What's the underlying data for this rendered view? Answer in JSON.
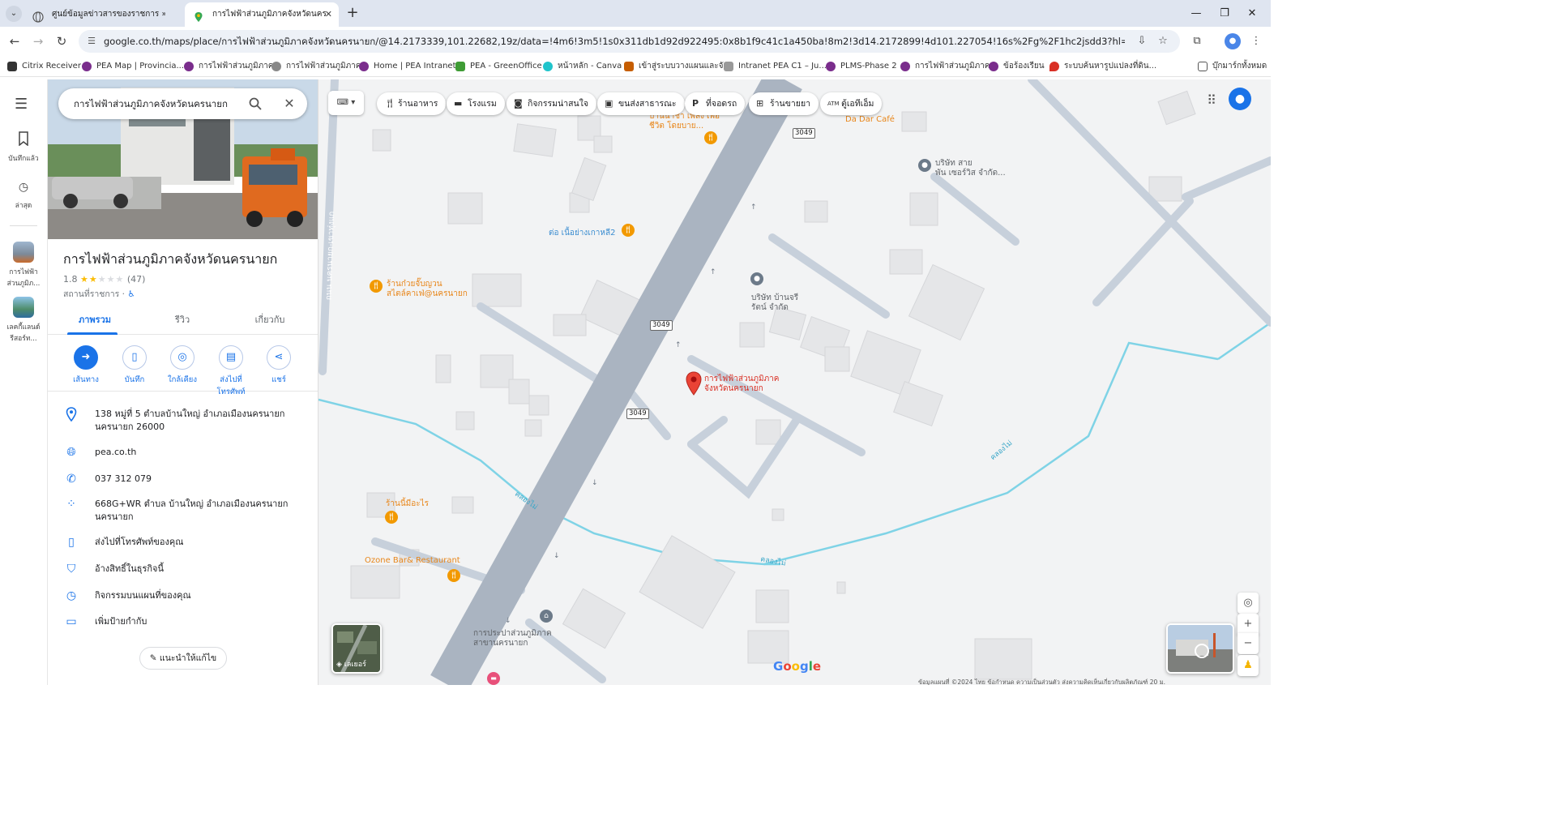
{
  "browser": {
    "tabs": [
      {
        "title": "ศูนย์ข้อมูลข่าวสารของราชการ » PEA",
        "active": false
      },
      {
        "title": "การไฟฟ้าส่วนภูมิภาคจังหวัดนครนายก",
        "active": true
      }
    ],
    "url": "google.co.th/maps/place/การไฟฟ้าส่วนภูมิภาคจังหวัดนครนายก/@14.2173339,101.22682,19z/data=!4m6!3m5!1s0x311db1d92d922495:0x8b1f9c41c1a450ba!8m2!3d14.2172899!4d101.227054!16s%2Fg%2F1hc2jsdd3?hl=th&entry=ttu",
    "bookmarks": [
      {
        "label": "Citrix Receiver",
        "color": "#333"
      },
      {
        "label": "PEA Map | Provincia...",
        "color": "#7a2d8c"
      },
      {
        "label": "การไฟฟ้าส่วนภูมิภาค",
        "color": "#7a2d8c"
      },
      {
        "label": "การไฟฟ้าส่วนภูมิภาค",
        "color": "#555"
      },
      {
        "label": "Home | PEA Intranet",
        "color": "#7a2d8c"
      },
      {
        "label": "PEA - GreenOffice",
        "color": "#3f9c35"
      },
      {
        "label": "หน้าหลัก - Canva",
        "color": "#20c4cb"
      },
      {
        "label": "เข้าสู่ระบบวางแผนและจั...",
        "color": "#c65d00"
      },
      {
        "label": "Intranet PEA C1 – Ju...",
        "color": "#888"
      },
      {
        "label": "PLMS-Phase 2",
        "color": "#7a2d8c"
      },
      {
        "label": "การไฟฟ้าส่วนภูมิภาค",
        "color": "#7a2d8c"
      },
      {
        "label": "ข้อร้องเรียน",
        "color": "#7a2d8c"
      },
      {
        "label": "ระบบค้นหารูปแปลงที่ดิน...",
        "color": "#d93025"
      }
    ],
    "all_bookmarks": "บุ๊กมาร์กทั้งหมด"
  },
  "rail": {
    "saved": "บันทึกแล้ว",
    "recent": "ล่าสุด",
    "recent_places": [
      "การไฟฟ้า ส่วนภูมิภ...",
      "เลคกี้แลนด์ รีสอร์ท..."
    ]
  },
  "search": {
    "query": "การไฟฟ้าส่วนภูมิภาคจังหวัดนครนายก"
  },
  "place": {
    "title": "การไฟฟ้าส่วนภูมิภาคจังหวัดนครนายก",
    "rating": "1.8",
    "rating_value": 1.8,
    "reviews": "(47)",
    "category": "สถานที่ราชการ",
    "tabs": [
      "ภาพรวม",
      "รีวิว",
      "เกี่ยวกับ"
    ],
    "actions": [
      "เส้นทาง",
      "บันทึก",
      "ใกล้เคียง",
      "ส่งไปที่โทรศัพท์",
      "แชร์"
    ],
    "address_1": "138 หมู่ที่ 5 ตำบลบ้านใหญ่ อำเภอเมืองนครนายก",
    "address_2": "นครนายก 26000",
    "website": "pea.co.th",
    "phone": "037 312 079",
    "plus_code_1": "668G+WR ตำบล บ้านใหญ่ อำเภอเมืองนครนายก",
    "plus_code_2": "นครนายก",
    "send_to_phone": "ส่งไปที่โทรศัพท์ของคุณ",
    "claim": "อ้างสิทธิ์ในธุรกิจนี้",
    "activity": "กิจกรรมบนแผนที่ของคุณ",
    "add_label": "เพิ่มป้ายกำกับ",
    "suggest_edit": "แนะนำให้แก้ไข"
  },
  "map": {
    "chips": [
      "ร้านอาหาร",
      "โรงแรม",
      "กิจกรรมน่าสนใจ",
      "ขนส่งสาธารณะ",
      "ที่จอดรถ",
      "ร้านขายยา",
      "ตู้เอทีเอ็ม"
    ],
    "layers_label": "เลเยอร์",
    "labels": {
      "dadar": "Da Dar Café",
      "cafe_top": "บ้านน้ำชา เพลง เพื่อชีวิต โดยบาย...",
      "korea": "ต่อ เนื้อย่างเกาหลี2",
      "noodle_1": "ร้านก๋วยจั๊บญวน",
      "noodle_2": "สไตล์คาเฟ่@นครนายก",
      "company1_1": "บริษัท สาย",
      "company1_2": "พัน เซอร์วิส จำกัด...",
      "company2_1": "บริษัท บ้านจรี",
      "company2_2": "รัตน์ จำกัด",
      "pea_1": "การไฟฟ้าส่วนภูมิภาค",
      "pea_2": "จังหวัดนครนายก",
      "eatery": "ร้านนี้มีอะไร",
      "ozone": "Ozone Bar& Restaurant",
      "pwa_1": "การประปาส่วนภูมิภาค",
      "pwa_2": "สาขานครนายก",
      "canal": "คลองไม่",
      "road_vertical": "ถนน นครนายก-เขาทุ่งแก"
    },
    "route_shield": "3049",
    "google": "Google",
    "footer": "ข้อมูลแผนที่ ©2024    ไทย    ข้อกำหนด    ความเป็นส่วนตัว    ส่งความคิดเห็นเกี่ยวกับผลิตภัณฑ์    20 ม."
  },
  "colors": {
    "accent": "#1a73e8",
    "pin": "#d93025",
    "poi": "#e8861a",
    "road": "#aab4c1",
    "water": "#7fd3e6"
  }
}
